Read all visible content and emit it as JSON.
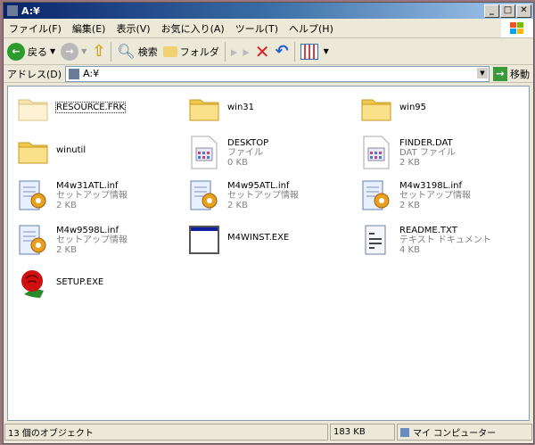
{
  "window": {
    "title": "A:¥"
  },
  "menu": [
    "ファイル(F)",
    "編集(E)",
    "表示(V)",
    "お気に入り(A)",
    "ツール(T)",
    "ヘルプ(H)"
  ],
  "toolbar": {
    "back": "戻る",
    "search": "検索",
    "folders": "フォルダ"
  },
  "address": {
    "label": "アドレス(D)",
    "value": "A:¥",
    "go": "移動"
  },
  "items": [
    {
      "name": "RESOURCE.FRK",
      "type": "folder-light"
    },
    {
      "name": "win31",
      "type": "folder"
    },
    {
      "name": "win95",
      "type": "folder"
    },
    {
      "name": "winutil",
      "type": "folder"
    },
    {
      "name": "DESKTOP",
      "kind": "ファイル",
      "size": "0 KB",
      "type": "file"
    },
    {
      "name": "FINDER.DAT",
      "kind": "DAT ファイル",
      "size": "2 KB",
      "type": "file"
    },
    {
      "name": "M4w31ATL.inf",
      "kind": "セットアップ情報",
      "size": "2 KB",
      "type": "inf"
    },
    {
      "name": "M4w95ATL.inf",
      "kind": "セットアップ情報",
      "size": "2 KB",
      "type": "inf"
    },
    {
      "name": "M4w3198L.inf",
      "kind": "セットアップ情報",
      "size": "2 KB",
      "type": "inf"
    },
    {
      "name": "M4w9598L.inf",
      "kind": "セットアップ情報",
      "size": "2 KB",
      "type": "inf"
    },
    {
      "name": "M4WINST.EXE",
      "type": "exe"
    },
    {
      "name": "README.TXT",
      "kind": "テキスト ドキュメント",
      "size": "4 KB",
      "type": "txt"
    },
    {
      "name": "SETUP.EXE",
      "type": "rose"
    }
  ],
  "status": {
    "count": "13 個のオブジェクト",
    "size": "183 KB",
    "location": "マイ コンピューター"
  }
}
